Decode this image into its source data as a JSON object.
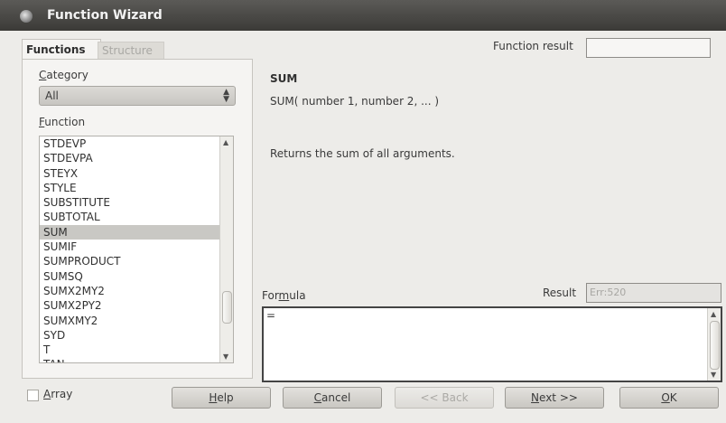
{
  "window": {
    "title": "Function Wizard"
  },
  "tabs": [
    {
      "label": "Functions",
      "active": true
    },
    {
      "label": "Structure",
      "active": false
    }
  ],
  "category": {
    "label": "Category",
    "value": "All"
  },
  "function_list": {
    "label": "Function",
    "items": [
      "STDEVP",
      "STDEVPA",
      "STEYX",
      "STYLE",
      "SUBSTITUTE",
      "SUBTOTAL",
      "SUM",
      "SUMIF",
      "SUMPRODUCT",
      "SUMSQ",
      "SUMX2MY2",
      "SUMX2PY2",
      "SUMXMY2",
      "SYD",
      "T",
      "TAN"
    ],
    "selected": "SUM"
  },
  "function_result": {
    "label": "Function result",
    "value": ""
  },
  "details": {
    "name": "SUM",
    "syntax": "SUM( number 1, number 2, ... )",
    "description": "Returns the sum of all arguments."
  },
  "formula": {
    "label": "Formula",
    "value": "="
  },
  "result": {
    "label": "Result",
    "value": "Err:520"
  },
  "array": {
    "label": "Array",
    "checked": false
  },
  "buttons": {
    "help": "Help",
    "cancel": "Cancel",
    "back": "<< Back",
    "next": "Next >>",
    "ok": "OK"
  }
}
